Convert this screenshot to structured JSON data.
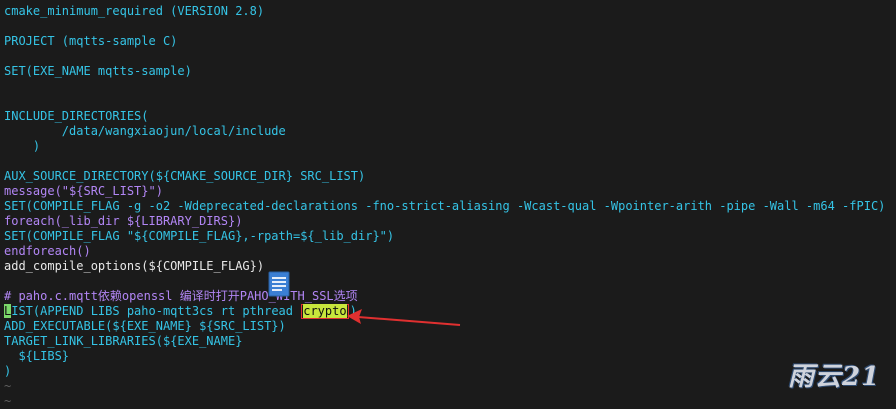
{
  "code": {
    "l1": "cmake_minimum_required (VERSION 2.8)",
    "l2": "PROJECT (mqtts-sample C)",
    "l3": "SET(EXE_NAME mqtts-sample)",
    "l4": "INCLUDE_DIRECTORIES(",
    "l5": "        /data/wangxiaojun/local/include",
    "l6": "    )",
    "l7": "AUX_SOURCE_DIRECTORY(${CMAKE_SOURCE_DIR} SRC_LIST)",
    "l8": "message(\"${SRC_LIST}\")",
    "l9": "SET(COMPILE_FLAG -g -o2 -Wdeprecated-declarations -fno-strict-aliasing -Wcast-qual -Wpointer-arith -pipe -Wall -m64 -fPIC)",
    "l10": "foreach(_lib_dir ${LIBRARY_DIRS})",
    "l11": "SET(COMPILE_FLAG \"${COMPILE_FLAG},-rpath=${_lib_dir}\")",
    "l12": "endforeach()",
    "l13": "add_compile_options(${COMPILE_FLAG})",
    "l14": "# paho.c.mqtt依赖openssl 编译时打开PAHO_WITH_SSL选项",
    "l15_cursor": "L",
    "l15_main": "IST(APPEND LIBS paho-mqtt3cs rt pthread ",
    "l15_crypto": "crypto",
    "l15_end": ")",
    "l16": "ADD_EXECUTABLE(${EXE_NAME} ${SRC_LIST})",
    "l17": "TARGET_LINK_LIBRARIES(${EXE_NAME}",
    "l18": "  ${LIBS}",
    "l19": ")",
    "tilde": "~"
  },
  "watermark": "雨云21",
  "icons": {
    "document": "document-icon",
    "arrow": "red-arrow-icon"
  },
  "colors": {
    "background": "#1b1b1b",
    "keyword": "#35c4e6",
    "string": "#b286f5",
    "highlight": "#c8e63c",
    "annotation": "#e03030"
  }
}
